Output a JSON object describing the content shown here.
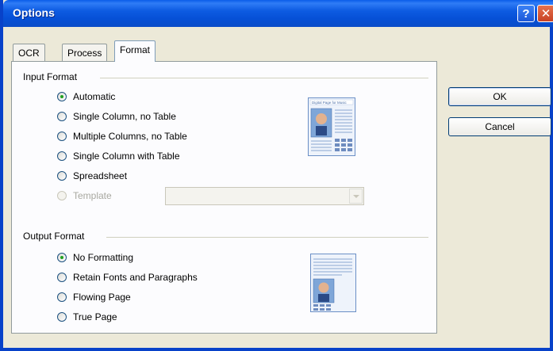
{
  "window": {
    "title": "Options"
  },
  "titlebar": {
    "help_label": "?",
    "close_label": "✕"
  },
  "tabs": [
    {
      "label": "OCR",
      "active": false
    },
    {
      "label": "Process",
      "active": false
    },
    {
      "label": "Format",
      "active": true
    }
  ],
  "input_format": {
    "label": "Input Format",
    "options": [
      {
        "label": "Automatic",
        "checked": true,
        "enabled": true
      },
      {
        "label": "Single Column, no Table",
        "checked": false,
        "enabled": true
      },
      {
        "label": "Multiple Columns, no Table",
        "checked": false,
        "enabled": true
      },
      {
        "label": "Single Column with Table",
        "checked": false,
        "enabled": true
      },
      {
        "label": "Spreadsheet",
        "checked": false,
        "enabled": true
      },
      {
        "label": "Template",
        "checked": false,
        "enabled": false
      }
    ],
    "template_select": {
      "value": ""
    },
    "preview_heading": "Digital Page for Music"
  },
  "output_format": {
    "label": "Output Format",
    "options": [
      {
        "label": "No Formatting",
        "checked": true
      },
      {
        "label": "Retain Fonts and Paragraphs",
        "checked": false
      },
      {
        "label": "Flowing Page",
        "checked": false
      },
      {
        "label": "True Page",
        "checked": false
      }
    ]
  },
  "buttons": {
    "ok": "OK",
    "cancel": "Cancel"
  }
}
